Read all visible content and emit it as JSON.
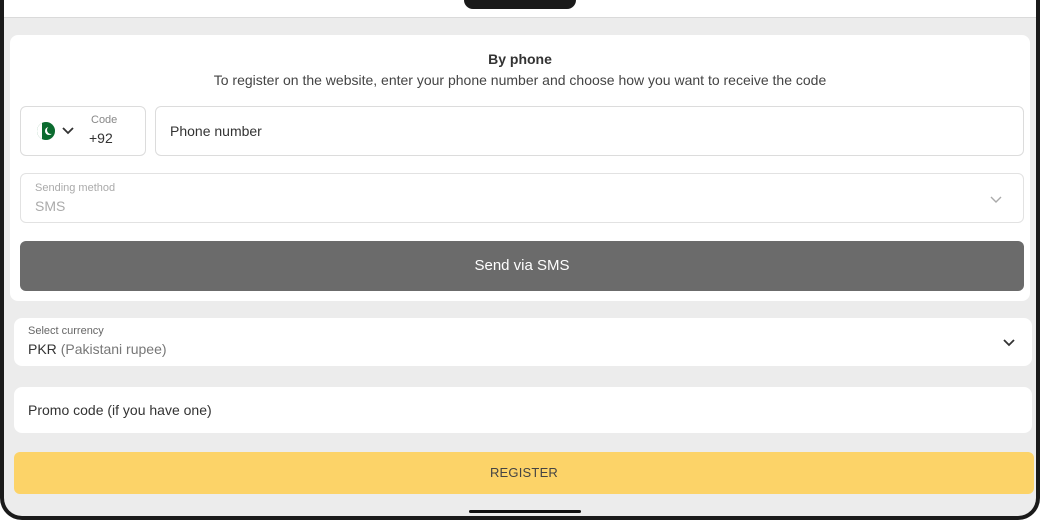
{
  "form": {
    "title": "By phone",
    "subtitle": "To register on the website, enter your phone number and choose how you want to receive the code"
  },
  "country_code": {
    "flag_icon": "pakistan-flag-icon",
    "dropdown_icon": "chevron-down-icon",
    "label": "Code",
    "value": "+92"
  },
  "phone": {
    "placeholder": "Phone number",
    "value": ""
  },
  "sending_method": {
    "label": "Sending method",
    "value": "SMS",
    "dropdown_icon": "chevron-down-icon"
  },
  "send_button": {
    "label": "Send via SMS"
  },
  "currency": {
    "label": "Select currency",
    "code": "PKR",
    "name": "(Pakistani rupee)",
    "dropdown_icon": "chevron-down-icon"
  },
  "promo": {
    "placeholder": "Promo code (if you have one)"
  },
  "register_button": {
    "label": "REGISTER"
  },
  "colors": {
    "send_button_bg": "#6b6b6b",
    "register_button_bg": "#fcd368",
    "page_bg": "#ececec"
  }
}
